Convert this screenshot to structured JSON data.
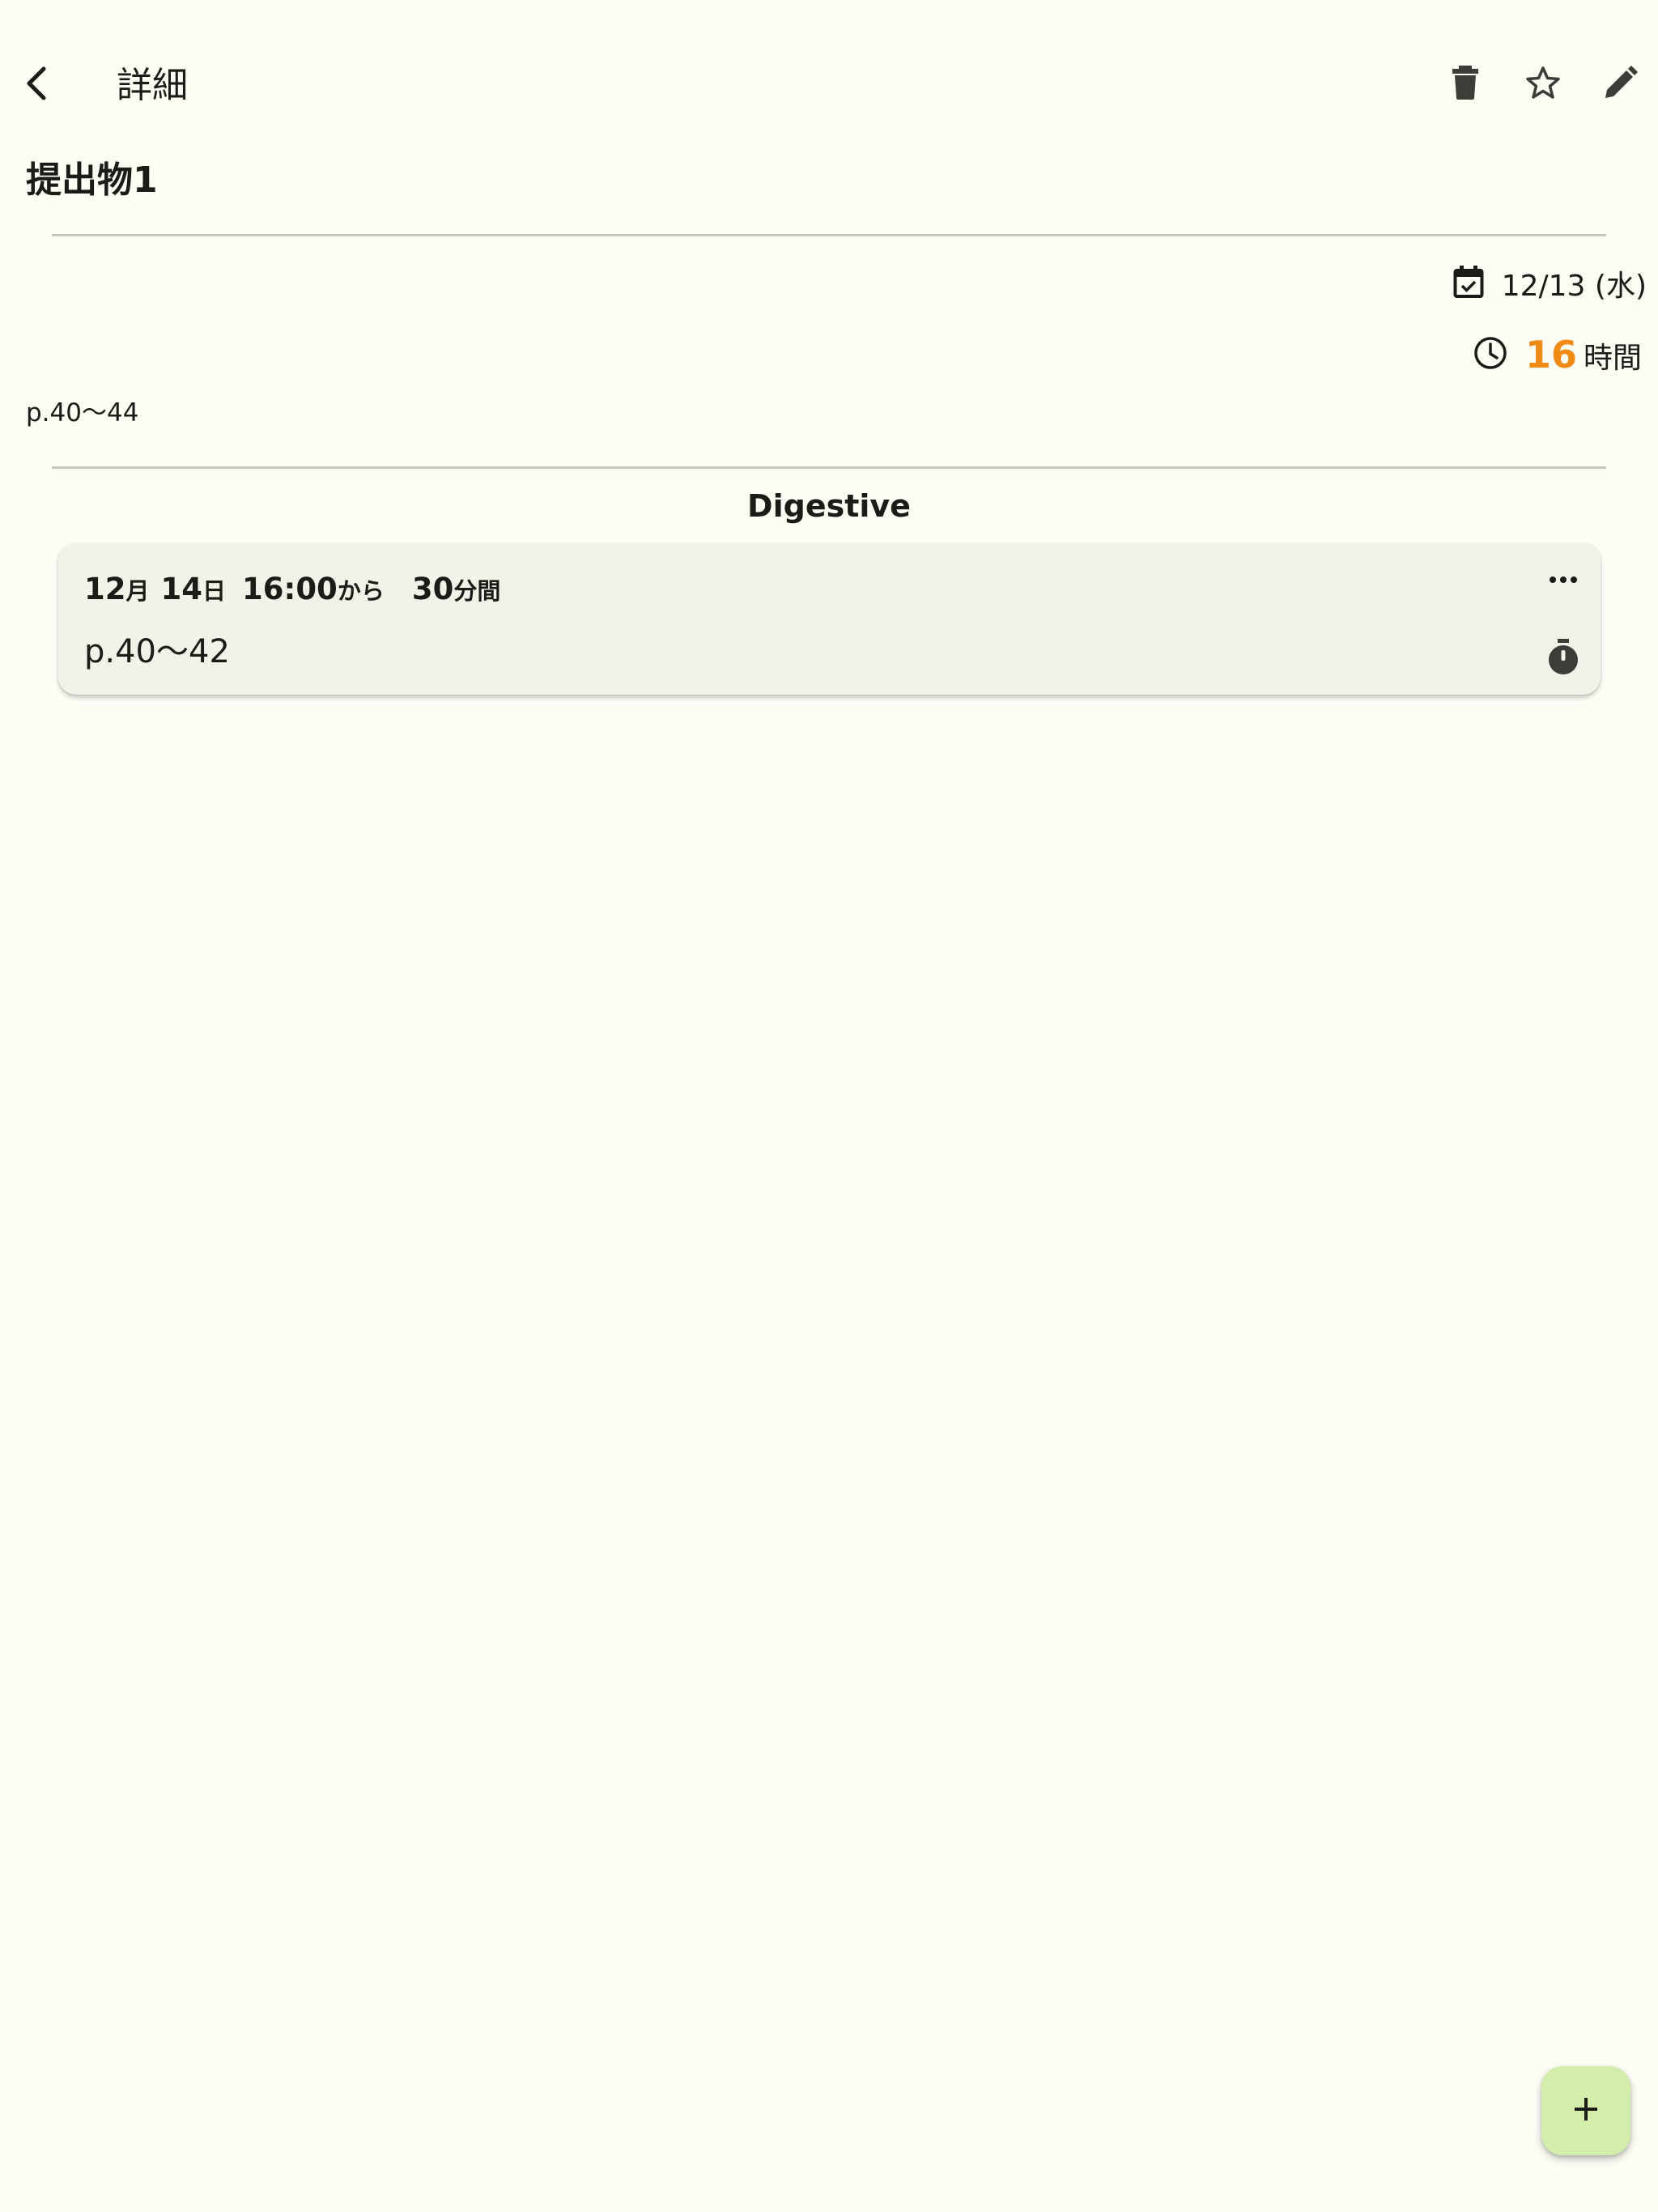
{
  "app_bar": {
    "title": "詳細",
    "back_icon": "chevron-left-icon",
    "actions": [
      {
        "name": "delete",
        "icon": "trash-icon"
      },
      {
        "name": "favorite",
        "icon": "star-outline-icon"
      },
      {
        "name": "edit",
        "icon": "pencil-icon"
      }
    ]
  },
  "task": {
    "title": "提出物1",
    "due_date": "12/13 (水)",
    "due_icon": "calendar-check-icon",
    "hours_value": "16",
    "hours_unit": "時間",
    "hours_icon": "clock-icon",
    "memo": "p.40〜44"
  },
  "section": {
    "title": "Digestive"
  },
  "sessions": [
    {
      "month": "12",
      "month_suffix": "月",
      "day": "14",
      "day_suffix": "日",
      "start_time": "16:00",
      "start_suffix": "から",
      "duration": "30",
      "duration_suffix": "分間",
      "memo": "p.40〜42",
      "more_icon": "more-horizontal-icon",
      "timer_icon": "stopwatch-icon"
    }
  ],
  "fab": {
    "icon": "plus-icon"
  },
  "colors": {
    "background": "#fdfdf6",
    "card": "#f1f3ea",
    "accent_hours": "#f28a16",
    "fab": "#d3edaa",
    "divider": "#c8c8c0",
    "icon": "#3b3d36"
  }
}
